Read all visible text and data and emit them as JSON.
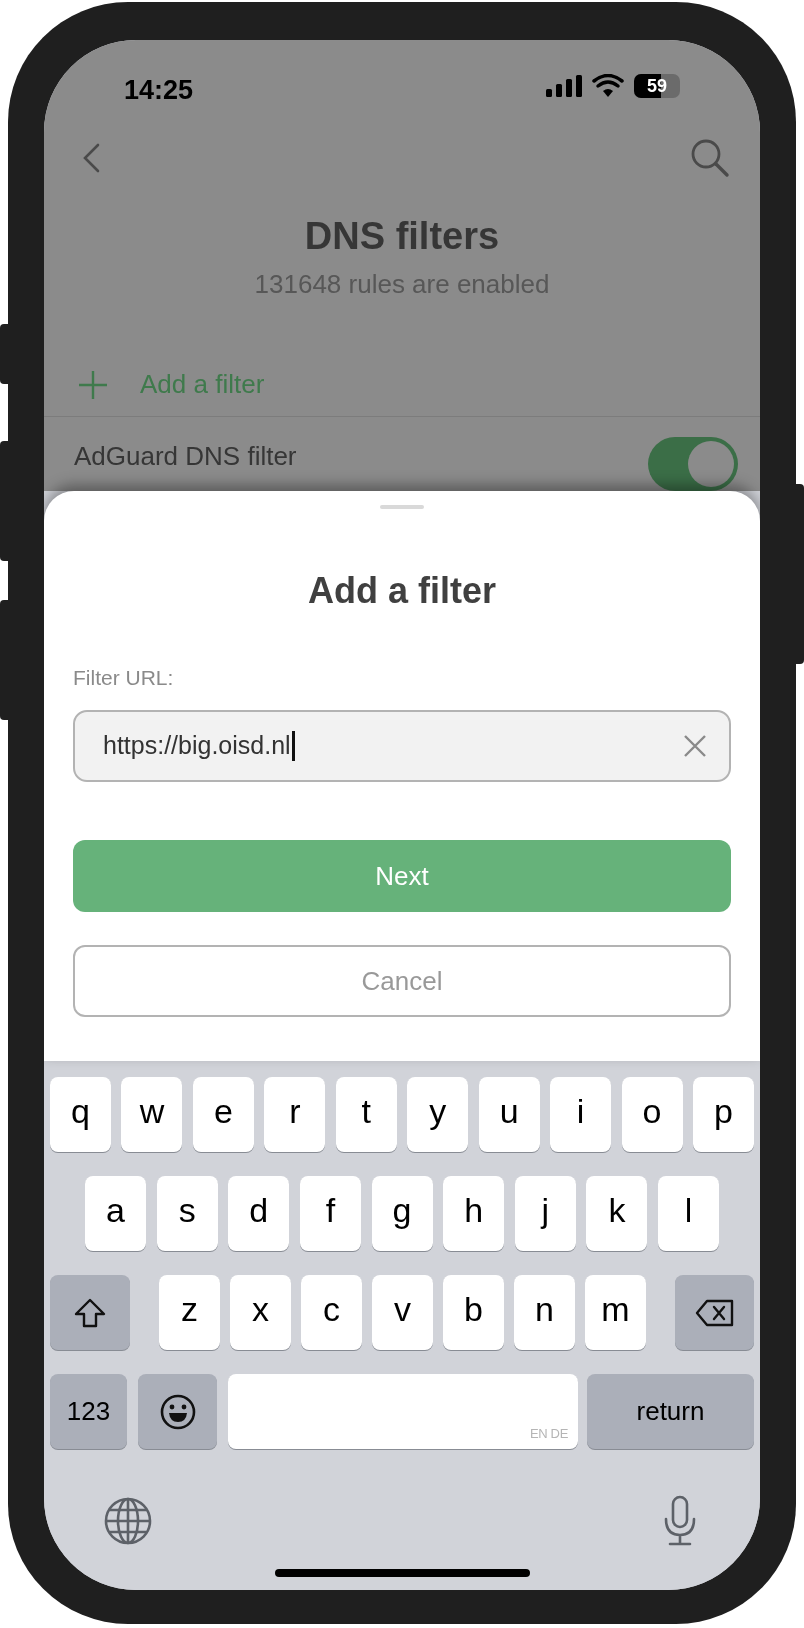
{
  "status_bar": {
    "time": "14:25",
    "battery": "59"
  },
  "header": {
    "title": "DNS filters",
    "subtitle": "131648 rules are enabled"
  },
  "add_row": {
    "label": "Add a filter"
  },
  "filters": [
    {
      "name": "AdGuard DNS filter",
      "on": true
    }
  ],
  "sheet": {
    "title": "Add a filter",
    "field": {
      "label": "Filter URL:",
      "value": "https://big.oisd.nl"
    },
    "buttons": [
      {
        "label": "Next",
        "kind": "primary"
      },
      {
        "label": "Cancel",
        "kind": "secondary"
      }
    ]
  },
  "keyboard": {
    "rows": [
      [
        {
          "kind": "letter",
          "label": "q"
        },
        {
          "kind": "letter",
          "label": "w"
        },
        {
          "kind": "letter",
          "label": "e"
        },
        {
          "kind": "letter",
          "label": "r"
        },
        {
          "kind": "letter",
          "label": "t"
        },
        {
          "kind": "letter",
          "label": "y"
        },
        {
          "kind": "letter",
          "label": "u"
        },
        {
          "kind": "letter",
          "label": "i"
        },
        {
          "kind": "letter",
          "label": "o"
        },
        {
          "kind": "letter",
          "label": "p"
        }
      ],
      [
        {
          "kind": "letter",
          "label": "a"
        },
        {
          "kind": "letter",
          "label": "s"
        },
        {
          "kind": "letter",
          "label": "d"
        },
        {
          "kind": "letter",
          "label": "f"
        },
        {
          "kind": "letter",
          "label": "g"
        },
        {
          "kind": "letter",
          "label": "h"
        },
        {
          "kind": "letter",
          "label": "j"
        },
        {
          "kind": "letter",
          "label": "k"
        },
        {
          "kind": "letter",
          "label": "l"
        }
      ],
      [
        {
          "kind": "shift"
        },
        {
          "kind": "letter",
          "label": "z"
        },
        {
          "kind": "letter",
          "label": "x"
        },
        {
          "kind": "letter",
          "label": "c"
        },
        {
          "kind": "letter",
          "label": "v"
        },
        {
          "kind": "letter",
          "label": "b"
        },
        {
          "kind": "letter",
          "label": "n"
        },
        {
          "kind": "letter",
          "label": "m"
        },
        {
          "kind": "delete"
        }
      ]
    ],
    "bottom_row": {
      "numbers_key": "123",
      "space_key": "EN DE",
      "return_key": "return"
    }
  }
}
